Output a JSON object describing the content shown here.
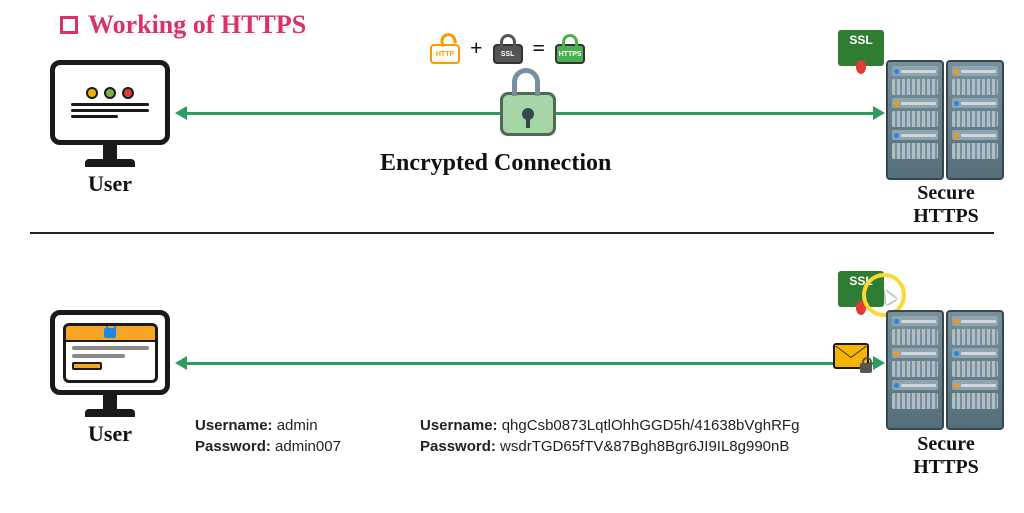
{
  "title": "Working of HTTPS",
  "equation": {
    "http_label": "HTTP",
    "plus": "+",
    "ssl_label": "SSL",
    "equals": "=",
    "https_label": "HTTPS"
  },
  "top": {
    "user_label": "User",
    "connection_label": "Encrypted Connection",
    "server_label_line1": "Secure",
    "server_label_line2": "HTTPS",
    "ssl_badge": "SSL"
  },
  "bottom": {
    "user_label": "User",
    "server_label_line1": "Secure",
    "server_label_line2": "HTTPS",
    "ssl_badge": "SSL",
    "plain_credentials": {
      "username_label": "Username:",
      "username_value": "admin",
      "password_label": "Password:",
      "password_value": "admin007"
    },
    "encrypted_credentials": {
      "username_label": "Username:",
      "username_value": "qhgCsb0873LqtlOhhGGD5h/41638bVghRFg",
      "password_label": "Password:",
      "password_value": "wsdrTGD65fTV&87Bgh8Bgr6JI9IL8g990nB"
    }
  }
}
